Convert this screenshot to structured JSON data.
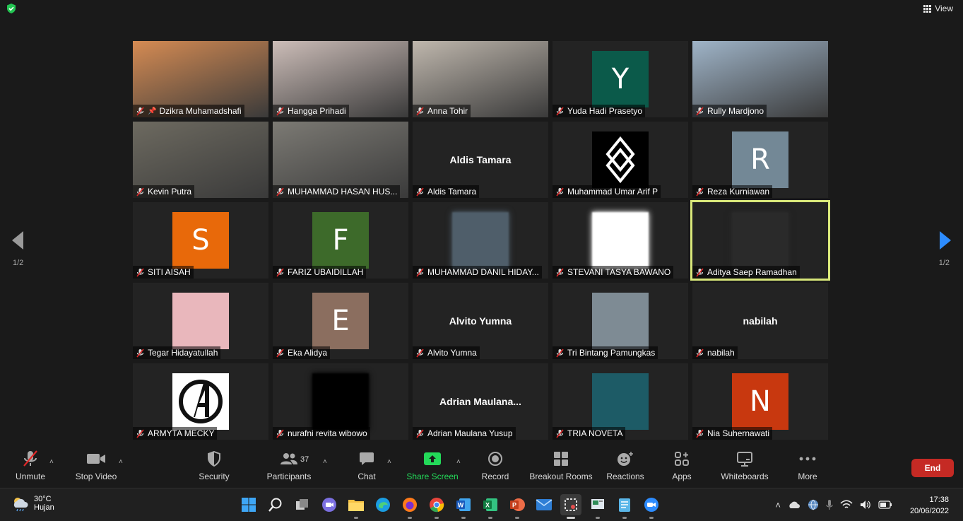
{
  "topbar": {
    "view_label": "View"
  },
  "pagination": {
    "left": "1/2",
    "right": "1/2"
  },
  "participants": [
    {
      "name": "Dzikra Muhamadshafi",
      "pinned": true,
      "kind": "photo",
      "bg": "#d58b53"
    },
    {
      "name": "Hangga Prihadi",
      "kind": "photo",
      "bg": "#ccbdb8"
    },
    {
      "name": "Anna Tohir",
      "kind": "photo",
      "bg": "#bfb7ad",
      "talking": true
    },
    {
      "name": "Yuda Hadi Prasetyo",
      "kind": "avatar",
      "letter": "Y",
      "color": "#0b5a4a"
    },
    {
      "name": "Rully Mardjono",
      "kind": "photo",
      "bg": "#9fb4c8"
    },
    {
      "name": "Kevin Putra",
      "kind": "photo",
      "bg": "#6d6a60"
    },
    {
      "name": "MUHAMMAD HASAN HUS...",
      "kind": "photo",
      "bg": "#7c7a74"
    },
    {
      "name": "Aldis Tamara",
      "kind": "name",
      "big": "Aldis Tamara"
    },
    {
      "name": "Muhammad Umar Arif P",
      "kind": "logo",
      "color": "#000000"
    },
    {
      "name": "Reza Kurniawan",
      "kind": "avatar",
      "letter": "R",
      "color": "#738896"
    },
    {
      "name": "SITI AISAH",
      "kind": "avatar",
      "letter": "S",
      "color": "#e8690a"
    },
    {
      "name": "FARIZ UBAIDILLAH",
      "kind": "avatar",
      "letter": "F",
      "color": "#3d6a2a"
    },
    {
      "name": "MUHAMMAD DANIL HIDAY...",
      "kind": "blur",
      "color": "#4f5e6a"
    },
    {
      "name": "STEVANI TASYA BAWANO",
      "kind": "blur",
      "color": "#ffffff"
    },
    {
      "name": "Aditya Saep Ramadhan",
      "kind": "blur",
      "color": "#2a2a2a",
      "active": true
    },
    {
      "name": "Tegar Hidayatullah",
      "kind": "photo-sq",
      "color": "#e9b7bc"
    },
    {
      "name": "Eka Alidya",
      "kind": "avatar",
      "letter": "E",
      "color": "#8b6e5f"
    },
    {
      "name": "Alvito Yumna",
      "kind": "name",
      "big": "Alvito Yumna"
    },
    {
      "name": "Tri Bintang Pamungkas",
      "kind": "photo-sq",
      "color": "#7e8b94"
    },
    {
      "name": "nabilah",
      "kind": "name",
      "big": "nabilah"
    },
    {
      "name": "ARMYTA MECKY",
      "kind": "avengers",
      "color": "#ffffff"
    },
    {
      "name": "nurafni revita wibowo",
      "kind": "blur",
      "color": "#000000"
    },
    {
      "name": "Adrian Maulana Yusup",
      "kind": "name",
      "big": "Adrian  Maulana..."
    },
    {
      "name": "TRIA NOVETA",
      "kind": "photo-sq",
      "color": "#1d5b66"
    },
    {
      "name": "Nia Suhernawati",
      "kind": "avatar",
      "letter": "N",
      "color": "#c8380f"
    }
  ],
  "toolbar": {
    "unmute": "Unmute",
    "stop_video": "Stop Video",
    "security": "Security",
    "participants": "Participants",
    "participants_count": "37",
    "chat": "Chat",
    "share_screen": "Share Screen",
    "record": "Record",
    "breakout_rooms": "Breakout Rooms",
    "reactions": "Reactions",
    "apps": "Apps",
    "whiteboards": "Whiteboards",
    "more": "More",
    "end": "End"
  },
  "taskbar": {
    "temperature": "30°C",
    "weather": "Hujan",
    "time": "17:38",
    "date": "20/06/2022"
  },
  "colors": {
    "share_green": "#23d959",
    "end_red": "#c52a24",
    "active_border": "#d9e87a",
    "accent_blue": "#2d8cff"
  }
}
